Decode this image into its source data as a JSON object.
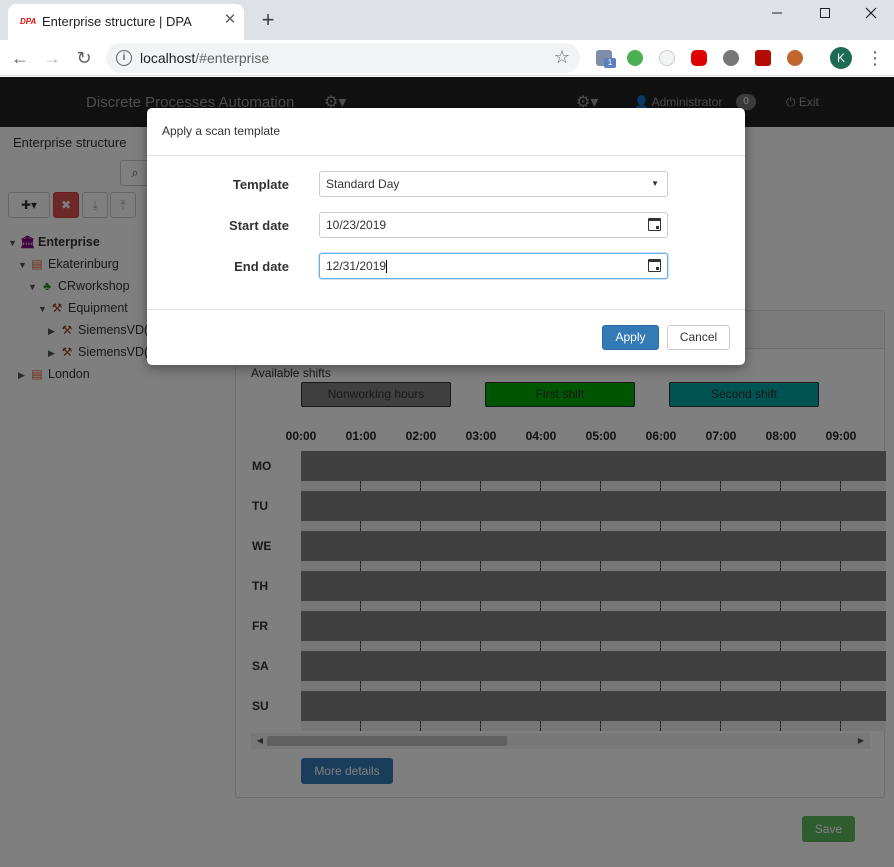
{
  "browser": {
    "tab_title": "Enterprise structure | DPA",
    "favicon_text": "DPA",
    "url_host": "localhost",
    "url_path": "/#enterprise",
    "profile_initial": "K",
    "extension_badge": "1"
  },
  "navbar": {
    "brand": "Discrete Processes Automation",
    "user": "Administrator",
    "badge": "0",
    "exit": "Exit"
  },
  "sidebar": {
    "title": "Enterprise structure",
    "tree": [
      {
        "label": "Enterprise",
        "icon": "building-icon"
      },
      {
        "label": "Ekaterinburg",
        "icon": "office-icon"
      },
      {
        "label": "CRworkshop",
        "icon": "sitemap-icon"
      },
      {
        "label": "Equipment",
        "icon": "gavel-icon"
      },
      {
        "label": "SiemensVD(",
        "icon": "gavel-icon"
      },
      {
        "label": "SiemensVD(",
        "icon": "gavel-icon"
      },
      {
        "label": "London",
        "icon": "office-icon"
      }
    ]
  },
  "schedule": {
    "available_label": "Available shifts",
    "shifts": [
      {
        "label": "Nonworking hours",
        "color": "#808080"
      },
      {
        "label": "First shift",
        "color": "#00aa00"
      },
      {
        "label": "Second shift",
        "color": "#00a7a7"
      }
    ],
    "hours": [
      "00:00",
      "01:00",
      "02:00",
      "03:00",
      "04:00",
      "05:00",
      "06:00",
      "07:00",
      "08:00",
      "09:00"
    ],
    "days": [
      "MO",
      "TU",
      "WE",
      "TH",
      "FR",
      "SA",
      "SU"
    ],
    "more_details": "More details",
    "save": "Save"
  },
  "modal": {
    "title": "Apply a scan template",
    "template_label": "Template",
    "template_value": "Standard Day",
    "start_label": "Start date",
    "start_value": "10/23/2019",
    "end_label": "End date",
    "end_value": "12/31/2019",
    "apply": "Apply",
    "cancel": "Cancel"
  },
  "colors": {
    "navbar": "#222222",
    "primary": "#337ab7",
    "danger": "#d9534f",
    "success": "#5cb85c"
  }
}
